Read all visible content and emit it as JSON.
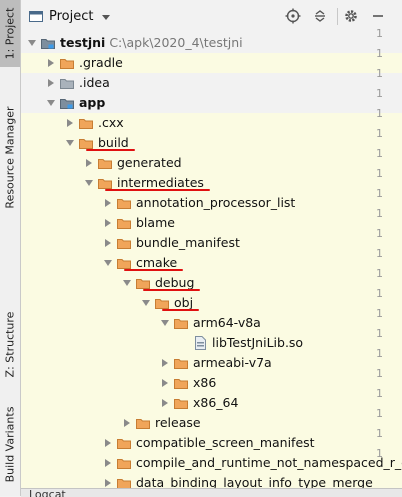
{
  "stripe": {
    "tabs": [
      {
        "label": "1: Project",
        "active": true
      },
      {
        "label": "Resource Manager",
        "active": false
      },
      {
        "label": "Z: Structure",
        "active": false
      },
      {
        "label": "Build Variants",
        "active": false
      }
    ]
  },
  "header": {
    "title": "Project",
    "icons": [
      "target-icon",
      "collapse-icon",
      "settings-icon",
      "minimize-icon"
    ]
  },
  "tree": [
    {
      "label": "testjni",
      "extra": "C:\\apk\\2020_4\\testjni",
      "depth": 0,
      "expanded": true,
      "icon": "module",
      "bold": true,
      "hl": false
    },
    {
      "label": ".gradle",
      "depth": 1,
      "expanded": false,
      "icon": "folder-orange",
      "hl": true
    },
    {
      "label": ".idea",
      "depth": 1,
      "expanded": false,
      "icon": "folder-gray",
      "hl": false
    },
    {
      "label": "app",
      "depth": 1,
      "expanded": true,
      "icon": "folder-module",
      "bold": true,
      "hl": false
    },
    {
      "label": ".cxx",
      "depth": 2,
      "expanded": false,
      "icon": "folder-orange",
      "hl": true
    },
    {
      "label": "build",
      "depth": 2,
      "expanded": true,
      "icon": "folder-orange",
      "hl": true,
      "underline": true
    },
    {
      "label": "generated",
      "depth": 3,
      "expanded": false,
      "icon": "folder-orange",
      "hl": true
    },
    {
      "label": "intermediates",
      "depth": 3,
      "expanded": true,
      "icon": "folder-orange",
      "hl": true,
      "underline": true
    },
    {
      "label": "annotation_processor_list",
      "depth": 4,
      "expanded": false,
      "icon": "folder-orange",
      "hl": true
    },
    {
      "label": "blame",
      "depth": 4,
      "expanded": false,
      "icon": "folder-orange",
      "hl": true
    },
    {
      "label": "bundle_manifest",
      "depth": 4,
      "expanded": false,
      "icon": "folder-orange",
      "hl": true
    },
    {
      "label": "cmake",
      "depth": 4,
      "expanded": true,
      "icon": "folder-orange",
      "hl": true,
      "underline": true
    },
    {
      "label": "debug",
      "depth": 5,
      "expanded": true,
      "icon": "folder-orange",
      "hl": true,
      "underline": true
    },
    {
      "label": "obj",
      "depth": 6,
      "expanded": true,
      "icon": "folder-orange",
      "hl": true,
      "underline": true
    },
    {
      "label": "arm64-v8a",
      "depth": 7,
      "expanded": true,
      "icon": "folder-orange",
      "hl": true
    },
    {
      "label": "libTestJniLib.so",
      "depth": 8,
      "leaf": true,
      "icon": "file-so",
      "hl": true
    },
    {
      "label": "armeabi-v7a",
      "depth": 7,
      "expanded": false,
      "icon": "folder-orange",
      "hl": true
    },
    {
      "label": "x86",
      "depth": 7,
      "expanded": false,
      "icon": "folder-orange",
      "hl": true
    },
    {
      "label": "x86_64",
      "depth": 7,
      "expanded": false,
      "icon": "folder-orange",
      "hl": true
    },
    {
      "label": "release",
      "depth": 5,
      "expanded": false,
      "icon": "folder-orange",
      "hl": true
    },
    {
      "label": "compatible_screen_manifest",
      "depth": 4,
      "expanded": false,
      "icon": "folder-orange",
      "hl": true
    },
    {
      "label": "compile_and_runtime_not_namespaced_r_clas",
      "depth": 4,
      "expanded": false,
      "icon": "folder-orange",
      "hl": true
    },
    {
      "label": "data_binding_layout_info_type_merge",
      "depth": 4,
      "expanded": false,
      "icon": "folder-orange",
      "hl": true
    }
  ],
  "gutter_marks": [
    "1",
    "1",
    "1",
    "1",
    "1",
    "1",
    "1",
    "1",
    "1",
    "1",
    "1",
    "1",
    "1",
    "1",
    "1",
    "1",
    "1",
    "1",
    "1",
    "1",
    "1",
    "1"
  ],
  "bottom": {
    "label": "Logcat"
  },
  "colors": {
    "highlight": "#fbfbe2",
    "folder": "#f0a55a",
    "underline": "#e01010"
  }
}
